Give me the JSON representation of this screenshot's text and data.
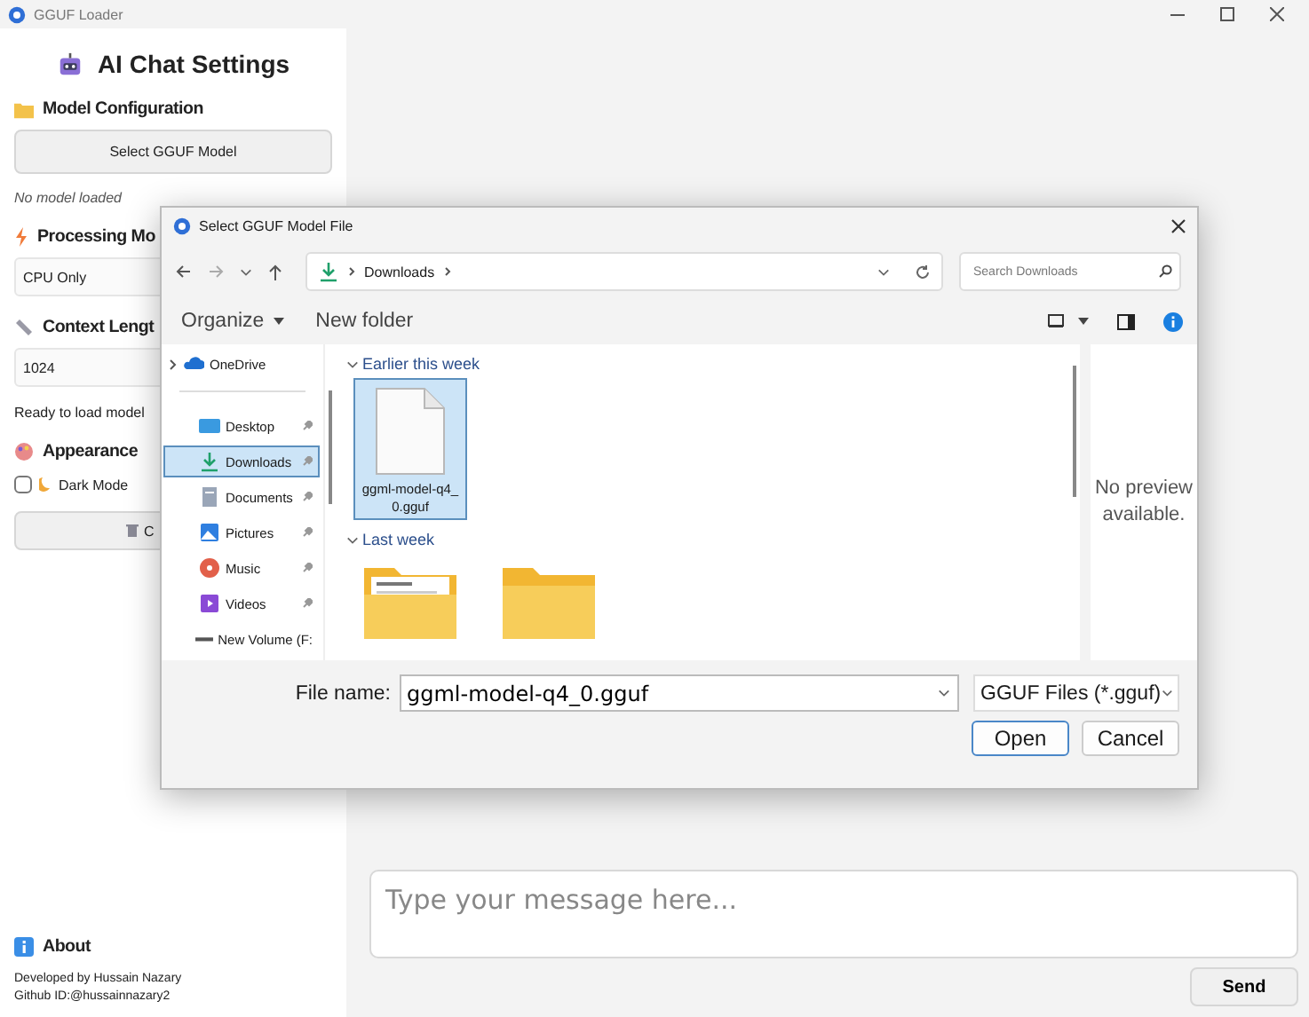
{
  "window": {
    "title": "GGUF Loader"
  },
  "sidebar": {
    "heading": "AI Chat Settings",
    "model_section": {
      "title": "Model Configuration",
      "button": "Select GGUF Model",
      "status": "No model loaded"
    },
    "processing_section": {
      "title": "Processing Mo",
      "field_value": "CPU Only"
    },
    "context_section": {
      "title": "Context Lengt",
      "field_value": "1024"
    },
    "ready_status": "Ready to load model",
    "appearance_section": {
      "title": "Appearance",
      "dark_mode": {
        "label": "Dark Mode",
        "checked": false
      }
    },
    "clear_button": "C",
    "about": {
      "title": "About",
      "lines": [
        "Developed by Hussain Nazary",
        "Github ID:@hussainnazary2"
      ]
    }
  },
  "chat": {
    "input": {
      "placeholder": "Type your message here..."
    },
    "send_button": "Send"
  },
  "dialog": {
    "title": "Select GGUF Model File",
    "breadcrumb": "Downloads",
    "search": {
      "placeholder": "Search Downloads"
    },
    "toolbar": [
      "Organize",
      "New folder"
    ],
    "nav_items": [
      {
        "label": "OneDrive",
        "kind": "cloud",
        "selected": false,
        "pinned": false
      },
      {
        "label": "Desktop",
        "kind": "desktop",
        "selected": false,
        "pinned": true
      },
      {
        "label": "Downloads",
        "kind": "download",
        "selected": true,
        "pinned": true
      },
      {
        "label": "Documents",
        "kind": "documents",
        "selected": false,
        "pinned": true
      },
      {
        "label": "Pictures",
        "kind": "pictures",
        "selected": false,
        "pinned": true
      },
      {
        "label": "Music",
        "kind": "music",
        "selected": false,
        "pinned": true
      },
      {
        "label": "Videos",
        "kind": "videos",
        "selected": false,
        "pinned": true
      },
      {
        "label": "New Volume (F:",
        "kind": "drive",
        "selected": false,
        "pinned": false
      }
    ],
    "groups": [
      {
        "title": "Earlier this week",
        "items": [
          {
            "name": "ggml-model-q4_0.gguf",
            "kind": "file",
            "selected": true
          }
        ]
      },
      {
        "title": "Last week",
        "items": [
          {
            "kind": "folder-doc",
            "selected": false
          },
          {
            "kind": "folder",
            "selected": false
          }
        ]
      }
    ],
    "preview_text": "No preview available.",
    "file_name_label": "File name:",
    "file_name": "ggml-model-q4_0.gguf",
    "file_type": "GGUF Files (*.gguf)",
    "buttons": [
      "Open",
      "Cancel"
    ]
  }
}
